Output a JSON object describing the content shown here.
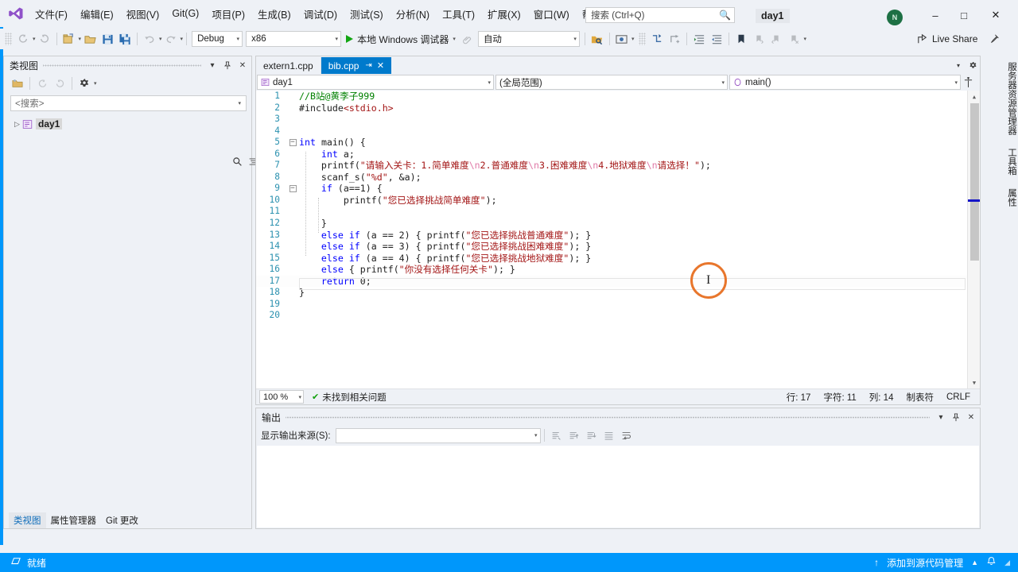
{
  "window": {
    "project_title": "day1",
    "avatar_initials": "N",
    "minimize": "–",
    "maximize": "□",
    "close": "✕"
  },
  "menubar": {
    "logo": "vs-logo-icon",
    "items": [
      {
        "label": "文件(F)"
      },
      {
        "label": "编辑(E)"
      },
      {
        "label": "视图(V)"
      },
      {
        "label": "Git(G)"
      },
      {
        "label": "项目(P)"
      },
      {
        "label": "生成(B)"
      },
      {
        "label": "调试(D)"
      },
      {
        "label": "测试(S)"
      },
      {
        "label": "分析(N)"
      },
      {
        "label": "工具(T)"
      },
      {
        "label": "扩展(X)"
      },
      {
        "label": "窗口(W)"
      },
      {
        "label": "帮助(H)"
      }
    ],
    "search": {
      "placeholder": "搜索 (Ctrl+Q)",
      "value": "搜索 (Ctrl+Q)",
      "icon": "search-icon"
    }
  },
  "toolbar": {
    "config_combo": {
      "value": "Debug"
    },
    "platform_combo": {
      "value": "x86"
    },
    "run_button": {
      "label": "本地 Windows 调试器"
    },
    "attach_combo": {
      "value": "自动"
    },
    "live_share": {
      "label": "Live Share"
    },
    "icons": [
      "navigate-back-icon",
      "navigate-forward-icon",
      "new-project-icon",
      "open-file-icon",
      "save-icon",
      "save-all-icon",
      "undo-icon",
      "redo-icon",
      "find-in-files-icon",
      "screenshot-icon",
      "step-into-icon",
      "step-over-icon",
      "indent-icon",
      "outdent-icon",
      "bookmark-icon",
      "next-bookmark-icon",
      "prev-bookmark-icon",
      "clear-bookmark-icon",
      "pin-icon"
    ]
  },
  "classview": {
    "title": "类视图",
    "header_buttons": [
      "chevron-down-icon",
      "pin-icon",
      "close-icon"
    ],
    "toolbar_icons": [
      "new-folder-icon",
      "back-icon",
      "forward-icon",
      "settings-gear-icon"
    ],
    "search": {
      "value": "<搜索>",
      "placeholder": "<搜索>"
    },
    "search_icons": [
      "search-icon",
      "list-icon"
    ],
    "tree": [
      {
        "label": "day1",
        "icon": "class-icon",
        "expander": "▷"
      }
    ],
    "bottom_tabs": [
      {
        "label": "类视图",
        "active": true
      },
      {
        "label": "属性管理器",
        "active": false
      },
      {
        "label": "Git 更改",
        "active": false
      }
    ]
  },
  "editor": {
    "tabs": [
      {
        "label": "extern1.cpp",
        "active": false,
        "pinned": false,
        "closable": false
      },
      {
        "label": "bib.cpp",
        "active": true,
        "pinned": true,
        "closable": true,
        "pin_glyph": "⇥",
        "close_glyph": "✕"
      }
    ],
    "nav": {
      "project": "day1",
      "scope": "(全局范围)",
      "member": "main()",
      "project_icon": "project-icon",
      "member_icon": "method-icon"
    },
    "lines": [
      {
        "n": 1,
        "fold": "",
        "indent": 0,
        "tokens": [
          {
            "t": "cm",
            "v": "//B站@黄李子999"
          }
        ]
      },
      {
        "n": 2,
        "fold": "",
        "indent": 0,
        "tokens": [
          {
            "t": "id",
            "v": "#include"
          },
          {
            "t": "s",
            "v": "<stdio.h>"
          }
        ]
      },
      {
        "n": 3,
        "fold": "",
        "indent": 0,
        "tokens": []
      },
      {
        "n": 4,
        "fold": "",
        "indent": 0,
        "tokens": []
      },
      {
        "n": 5,
        "fold": "-",
        "indent": 0,
        "tokens": [
          {
            "t": "k",
            "v": "int"
          },
          {
            "t": "id",
            "v": " "
          },
          {
            "t": "fn",
            "v": "main"
          },
          {
            "t": "id",
            "v": "() {"
          }
        ]
      },
      {
        "n": 6,
        "fold": "",
        "indent": 1,
        "tokens": [
          {
            "t": "id",
            "v": "    "
          },
          {
            "t": "k",
            "v": "int"
          },
          {
            "t": "id",
            "v": " a;"
          }
        ]
      },
      {
        "n": 7,
        "fold": "",
        "indent": 1,
        "tokens": [
          {
            "t": "id",
            "v": "    "
          },
          {
            "t": "fn",
            "v": "printf"
          },
          {
            "t": "id",
            "v": "("
          },
          {
            "t": "s",
            "v": "\"请输入关卡：1.简单难度"
          },
          {
            "t": "esc",
            "v": "\\n"
          },
          {
            "t": "s",
            "v": "2.普通难度"
          },
          {
            "t": "esc",
            "v": "\\n"
          },
          {
            "t": "s",
            "v": "3.困难难度"
          },
          {
            "t": "esc",
            "v": "\\n"
          },
          {
            "t": "s",
            "v": "4.地狱难度"
          },
          {
            "t": "esc",
            "v": "\\n"
          },
          {
            "t": "s",
            "v": "请选择！\""
          },
          {
            "t": "id",
            "v": ");"
          }
        ]
      },
      {
        "n": 8,
        "fold": "",
        "indent": 1,
        "tokens": [
          {
            "t": "id",
            "v": "    "
          },
          {
            "t": "fn",
            "v": "scanf_s"
          },
          {
            "t": "id",
            "v": "("
          },
          {
            "t": "s",
            "v": "\"%d\""
          },
          {
            "t": "id",
            "v": ", &a);"
          }
        ]
      },
      {
        "n": 9,
        "fold": "-",
        "indent": 1,
        "tokens": [
          {
            "t": "id",
            "v": "    "
          },
          {
            "t": "k",
            "v": "if"
          },
          {
            "t": "id",
            "v": " (a==1) {"
          }
        ]
      },
      {
        "n": 10,
        "fold": "",
        "indent": 2,
        "tokens": [
          {
            "t": "id",
            "v": "        "
          },
          {
            "t": "fn",
            "v": "printf"
          },
          {
            "t": "id",
            "v": "("
          },
          {
            "t": "s",
            "v": "\"您已选择挑战简单难度\""
          },
          {
            "t": "id",
            "v": ");"
          }
        ]
      },
      {
        "n": 11,
        "fold": "",
        "indent": 2,
        "tokens": []
      },
      {
        "n": 12,
        "fold": "",
        "indent": 1,
        "tokens": [
          {
            "t": "id",
            "v": "    }"
          }
        ]
      },
      {
        "n": 13,
        "fold": "",
        "indent": 1,
        "tokens": [
          {
            "t": "id",
            "v": "    "
          },
          {
            "t": "k",
            "v": "else"
          },
          {
            "t": "id",
            "v": " "
          },
          {
            "t": "k",
            "v": "if"
          },
          {
            "t": "id",
            "v": " (a == 2) { "
          },
          {
            "t": "fn",
            "v": "printf"
          },
          {
            "t": "id",
            "v": "("
          },
          {
            "t": "s",
            "v": "\"您已选择挑战普通难度\""
          },
          {
            "t": "id",
            "v": "); }"
          }
        ]
      },
      {
        "n": 14,
        "fold": "",
        "indent": 1,
        "tokens": [
          {
            "t": "id",
            "v": "    "
          },
          {
            "t": "k",
            "v": "else"
          },
          {
            "t": "id",
            "v": " "
          },
          {
            "t": "k",
            "v": "if"
          },
          {
            "t": "id",
            "v": " (a == 3) { "
          },
          {
            "t": "fn",
            "v": "printf"
          },
          {
            "t": "id",
            "v": "("
          },
          {
            "t": "s",
            "v": "\"您已选择挑战困难难度\""
          },
          {
            "t": "id",
            "v": "); }"
          }
        ]
      },
      {
        "n": 15,
        "fold": "",
        "indent": 1,
        "tokens": [
          {
            "t": "id",
            "v": "    "
          },
          {
            "t": "k",
            "v": "else"
          },
          {
            "t": "id",
            "v": " "
          },
          {
            "t": "k",
            "v": "if"
          },
          {
            "t": "id",
            "v": " (a == 4) { "
          },
          {
            "t": "fn",
            "v": "printf"
          },
          {
            "t": "id",
            "v": "("
          },
          {
            "t": "s",
            "v": "\"您已选择挑战地狱难度\""
          },
          {
            "t": "id",
            "v": "); }"
          }
        ]
      },
      {
        "n": 16,
        "fold": "",
        "indent": 1,
        "tokens": [
          {
            "t": "id",
            "v": "    "
          },
          {
            "t": "k",
            "v": "else"
          },
          {
            "t": "id",
            "v": " { "
          },
          {
            "t": "fn",
            "v": "printf"
          },
          {
            "t": "id",
            "v": "("
          },
          {
            "t": "s",
            "v": "\"你没有选择任何关卡\""
          },
          {
            "t": "id",
            "v": "); }"
          }
        ]
      },
      {
        "n": 17,
        "fold": "",
        "indent": 1,
        "current": true,
        "tokens": [
          {
            "t": "id",
            "v": "    "
          },
          {
            "t": "k",
            "v": "return"
          },
          {
            "t": "id",
            "v": " 0;"
          }
        ]
      },
      {
        "n": 18,
        "fold": "",
        "indent": 0,
        "tokens": [
          {
            "t": "id",
            "v": "}"
          }
        ]
      },
      {
        "n": 19,
        "fold": "",
        "indent": 0,
        "tokens": []
      },
      {
        "n": 20,
        "fold": "",
        "indent": 0,
        "tokens": []
      }
    ],
    "status": {
      "zoom": "100 %",
      "issues": "未找到相关问题",
      "issues_icon": "check-circle-icon",
      "row": "行: 17",
      "chars": "字符: 11",
      "col": "列: 14",
      "tabs": "制表符",
      "eol": "CRLF"
    }
  },
  "output_panel": {
    "title": "输出",
    "header_buttons": [
      "chevron-down-icon",
      "pin-icon",
      "close-icon"
    ],
    "source_label": "显示输出来源(S):",
    "source_value": "",
    "toolbar_icons": [
      "find-message-icon",
      "go-to-prev-icon",
      "go-to-next-icon",
      "clear-all-icon",
      "word-wrap-icon"
    ]
  },
  "right_tabs": [
    {
      "label": "服务器资源管理器"
    },
    {
      "label": "工具箱"
    },
    {
      "label": "属性"
    }
  ],
  "statusbar": {
    "ready": "就绪",
    "ready_icon": "stop-icon",
    "source_control": "添加到源代码管理",
    "source_control_icon": "arrow-up-icon",
    "expand_icon": "chevron-up-icon",
    "notification_icon": "bell-icon"
  },
  "cursor": {
    "highlight_color": "#e8762c",
    "glyph": "I"
  }
}
